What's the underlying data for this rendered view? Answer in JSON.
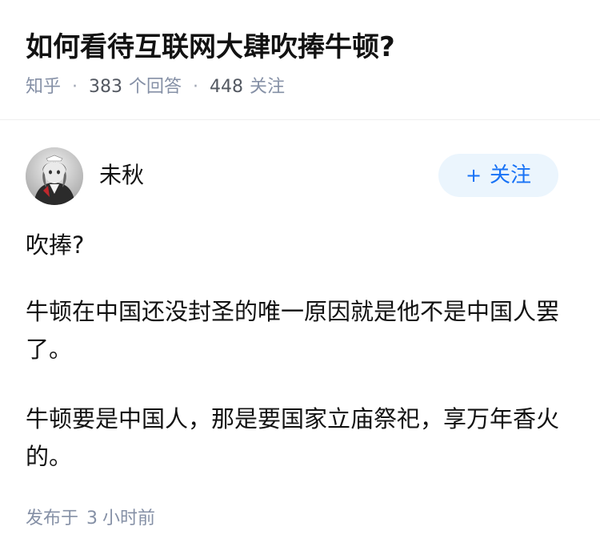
{
  "question": {
    "title": "如何看待互联网大肆吹捧牛顿?",
    "source": "知乎",
    "answer_count": "383",
    "answer_label": "个回答",
    "follower_count": "448",
    "follower_label": "关注",
    "separator": "·"
  },
  "answer": {
    "author_name": "未秋",
    "follow_plus": "+",
    "follow_label": "关注",
    "paragraphs": [
      "吹捧?",
      "牛顿在中国还没封圣的唯一原因就是他不是中国人罢了。",
      "牛顿要是中国人，那是要国家立庙祭祀，享万年香火的。"
    ],
    "published_prefix": "发布于",
    "published_num": "3",
    "published_suffix": "小时前"
  }
}
